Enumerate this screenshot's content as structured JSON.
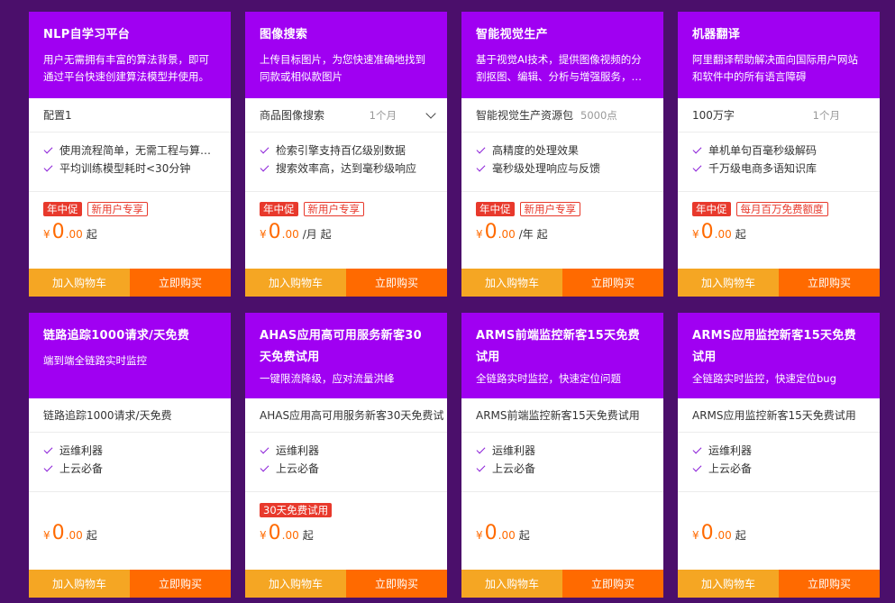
{
  "cards": [
    {
      "title": "NLP自学习平台",
      "desc": "用户无需拥有丰富的算法背景，即可通过平台快速创建算法模型并使用。",
      "spec": "配置1",
      "period": "",
      "points": "",
      "features": [
        "使用流程简单，无需工程与算…",
        "平均训练模型耗时<30分钟"
      ],
      "tag1": "年中促",
      "tag2": "新用户专享",
      "currency": "¥",
      "price_int": "0",
      "price_dec": ".00",
      "unit": "起",
      "cart_label": "加入购物车",
      "buy_label": "立即购买"
    },
    {
      "title": "图像搜索",
      "desc": "上传目标图片，为您快速准确地找到同款或相似款图片",
      "spec": "商品图像搜索",
      "period": "1个月",
      "points": "",
      "features": [
        "检索引擎支持百亿级别数据",
        "搜索效率高，达到毫秒级响应"
      ],
      "tag1": "年中促",
      "tag2": "新用户专享",
      "currency": "¥",
      "price_int": "0",
      "price_dec": ".00",
      "unit": "/月 起",
      "cart_label": "加入购物车",
      "buy_label": "立即购买"
    },
    {
      "title": "智能视觉生产",
      "desc": "基于视觉AI技术，提供图像视频的分割抠图、编辑、分析与增强服务，…",
      "spec": "智能视觉生产资源包",
      "period": "",
      "points": "5000点",
      "features": [
        "高精度的处理效果",
        "毫秒级处理响应与反馈"
      ],
      "tag1": "年中促",
      "tag2": "新用户专享",
      "currency": "¥",
      "price_int": "0",
      "price_dec": ".00",
      "unit": "/年 起",
      "cart_label": "加入购物车",
      "buy_label": "立即购买"
    },
    {
      "title": "机器翻译",
      "desc": "阿里翻译帮助解决面向国际用户网站和软件中的所有语言障碍",
      "spec": "100万字",
      "period": "1个月",
      "points": "",
      "features": [
        "单机单句百毫秒级解码",
        "千万级电商多语知识库"
      ],
      "tag1": "年中促",
      "tag2": "每月百万免费额度",
      "currency": "¥",
      "price_int": "0",
      "price_dec": ".00",
      "unit": "起",
      "cart_label": "加入购物车",
      "buy_label": "立即购买"
    },
    {
      "title": "链路追踪1000请求/天免费",
      "desc": "端到端全链路实时监控",
      "spec": "链路追踪1000请求/天免费",
      "period": "",
      "points": "",
      "features": [
        "运维利器",
        "上云必备"
      ],
      "tag1": "",
      "tag2": "",
      "currency": "¥",
      "price_int": "0",
      "price_dec": ".00",
      "unit": "起",
      "cart_label": "加入购物车",
      "buy_label": "立即购买"
    },
    {
      "title": "AHAS应用高可用服务新客30天免费试用",
      "desc": "一键限流降级，应对流量洪峰",
      "spec": "AHAS应用高可用服务新客30天免费试",
      "period": "",
      "points": "",
      "features": [
        "运维利器",
        "上云必备"
      ],
      "tag1": "30天免费试用",
      "tag2": "",
      "currency": "¥",
      "price_int": "0",
      "price_dec": ".00",
      "unit": "起",
      "cart_label": "加入购物车",
      "buy_label": "立即购买"
    },
    {
      "title": "ARMS前端监控新客15天免费试用",
      "desc": "全链路实时监控，快速定位问题",
      "spec": "ARMS前端监控新客15天免费试用",
      "period": "",
      "points": "",
      "features": [
        "运维利器",
        "上云必备"
      ],
      "tag1": "",
      "tag2": "",
      "currency": "¥",
      "price_int": "0",
      "price_dec": ".00",
      "unit": "起",
      "cart_label": "加入购物车",
      "buy_label": "立即购买"
    },
    {
      "title": "ARMS应用监控新客15天免费试用",
      "desc": "全链路实时监控，快速定位bug",
      "spec": "ARMS应用监控新客15天免费试用",
      "period": "",
      "points": "",
      "features": [
        "运维利器",
        "上云必备"
      ],
      "tag1": "",
      "tag2": "",
      "currency": "¥",
      "price_int": "0",
      "price_dec": ".00",
      "unit": "起",
      "cart_label": "加入购物车",
      "buy_label": "立即购买"
    }
  ]
}
